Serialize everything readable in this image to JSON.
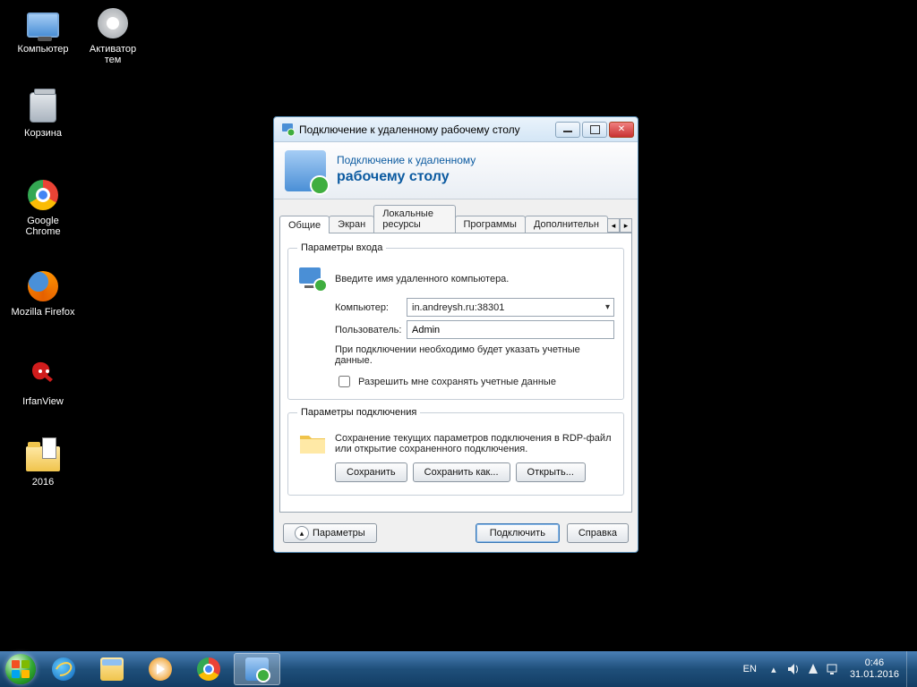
{
  "desktop": {
    "icons": [
      {
        "label": "Компьютер",
        "kind": "computer"
      },
      {
        "label": "Активатор тем",
        "kind": "gear"
      },
      {
        "label": "Корзина",
        "kind": "bin"
      },
      {
        "label": "Google Chrome",
        "kind": "chrome"
      },
      {
        "label": "Mozilla Firefox",
        "kind": "firefox"
      },
      {
        "label": "IrfanView",
        "kind": "irfan"
      },
      {
        "label": "2016",
        "kind": "folder"
      }
    ]
  },
  "window": {
    "title": "Подключение к удаленному рабочему столу",
    "banner_line1": "Подключение к удаленному",
    "banner_line2": "рабочему столу",
    "tabs": [
      "Общие",
      "Экран",
      "Локальные ресурсы",
      "Программы",
      "Дополнительн"
    ],
    "active_tab": 0,
    "login_group": "Параметры входа",
    "login_instr": "Введите имя удаленного компьютера.",
    "computer_lbl": "Компьютер:",
    "computer_val": "in.andreysh.ru:38301",
    "user_lbl": "Пользователь:",
    "user_val": "Admin",
    "cred_note": "При подключении необходимо будет указать учетные данные.",
    "allow_save": "Разрешить мне сохранять учетные данные",
    "conn_group": "Параметры подключения",
    "conn_note": "Сохранение текущих параметров подключения в RDP-файл или открытие сохраненного подключения.",
    "btn_save": "Сохранить",
    "btn_save_as": "Сохранить как...",
    "btn_open": "Открыть...",
    "btn_options": "Параметры",
    "btn_connect": "Подключить",
    "btn_help": "Справка"
  },
  "tray": {
    "lang": "EN",
    "time": "0:46",
    "date": "31.01.2016"
  }
}
